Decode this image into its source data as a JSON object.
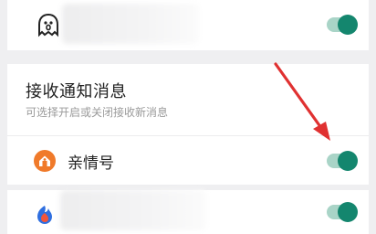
{
  "section": {
    "title": "接收通知消息",
    "subtitle": "可选择开启或关闭接收新消息"
  },
  "rows": [
    {
      "icon": "ghost-face-icon",
      "label": "",
      "label_hidden": true,
      "enabled": true
    },
    {
      "icon": "house-badge-icon",
      "label": "亲情号",
      "label_hidden": false,
      "enabled": true
    },
    {
      "icon": "app-flame-icon",
      "label": "",
      "label_hidden": true,
      "enabled": true
    }
  ],
  "annotation": {
    "type": "red-arrow",
    "points_to": "rows.1.toggle"
  },
  "colors": {
    "accent": "#14866e",
    "track": "#a9d4c7",
    "annotation": "#e03131",
    "badge_orange": "#f07a2a"
  }
}
